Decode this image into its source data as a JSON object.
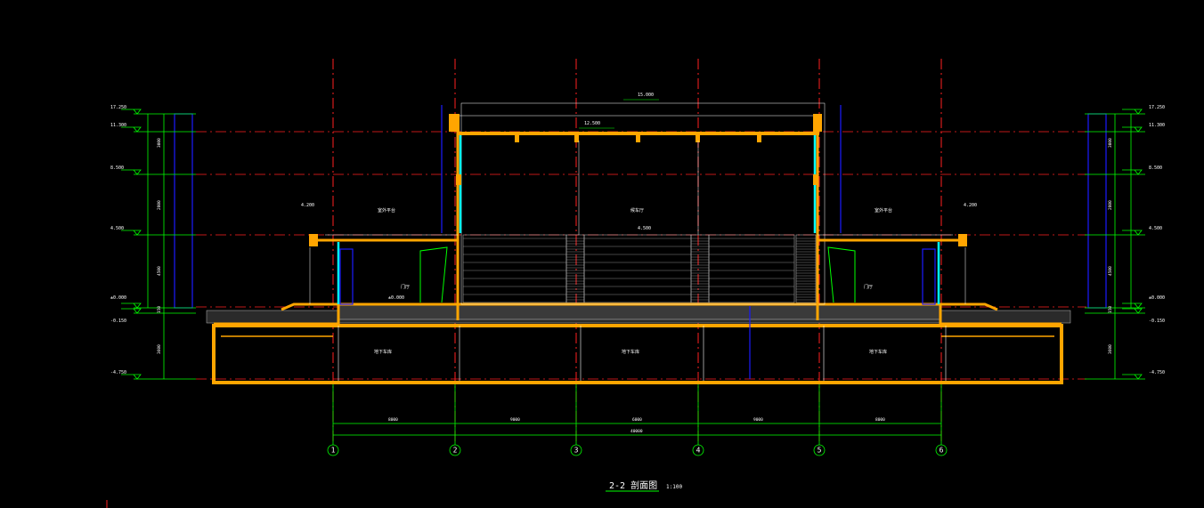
{
  "drawing": {
    "title": "2-2 剖面图",
    "scale": "1:100",
    "colors": {
      "background": "#000000",
      "axis_lines": "#ff2020",
      "structure": "#ffa500",
      "dimensions": "#00ff00",
      "glazing": "#00ffff",
      "frames": "#1a1aff",
      "thin_lines": "#ffffff"
    }
  },
  "axes": [
    "1",
    "2",
    "3",
    "4",
    "5",
    "6"
  ],
  "elevations_left": [
    "17.250",
    "11.300",
    "8.500",
    "4.500",
    "±0.000",
    "-0.150",
    "-4.750"
  ],
  "elevations_right": [
    "17.250",
    "11.300",
    "8.500",
    "4.500",
    "±0.000",
    "-0.150",
    "-4.750"
  ],
  "top_elevations": {
    "roof_top": "15.000",
    "roof": "12.500",
    "platform_left": "4.200",
    "platform_right": "4.200",
    "mid": "4.500"
  },
  "rooms": {
    "left_upper": "室外平台",
    "center_upper": "候车厅",
    "right_upper": "室外平台",
    "basement_left": "地下车库",
    "basement_center": "地下车库",
    "basement_right": "地下车库",
    "door_left": "门厅",
    "door_right": "门厅",
    "ground_mark": "±0.000"
  },
  "dimensions_bottom": [
    "8000",
    "9000",
    "6000",
    "9000",
    "8000"
  ],
  "dimension_total": "40000",
  "dimensions_left_vertical": [
    "3000",
    "2800",
    "4500",
    "150",
    "3600"
  ],
  "dimensions_right_vertical": [
    "3000",
    "2800",
    "4500",
    "150",
    "3600"
  ]
}
